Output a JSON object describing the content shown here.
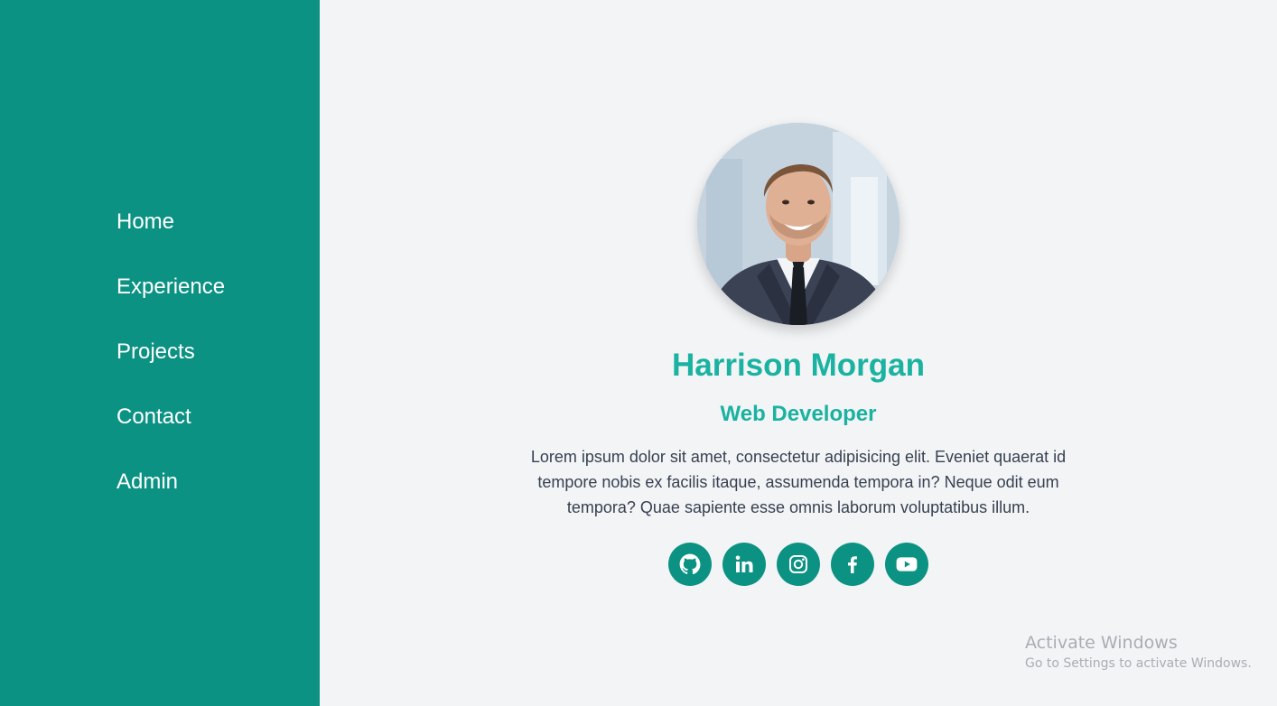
{
  "sidebar": {
    "items": [
      {
        "label": "Home"
      },
      {
        "label": "Experience"
      },
      {
        "label": "Projects"
      },
      {
        "label": "Contact"
      },
      {
        "label": "Admin"
      }
    ]
  },
  "profile": {
    "name": "Harrison Morgan",
    "role": "Web Developer",
    "bio": "Lorem ipsum dolor sit amet, consectetur adipisicing elit. Eveniet quaerat id tempore nobis ex facilis itaque, assumenda tempora in? Neque odit eum tempora? Quae sapiente esse omnis laborum voluptatibus illum."
  },
  "socials": [
    {
      "icon": "github-icon"
    },
    {
      "icon": "linkedin-icon"
    },
    {
      "icon": "instagram-icon"
    },
    {
      "icon": "facebook-icon"
    },
    {
      "icon": "youtube-icon"
    }
  ],
  "watermark": {
    "title": "Activate Windows",
    "subtitle": "Go to Settings to activate Windows."
  },
  "colors": {
    "sidebar": "#0c9283",
    "accent": "#1ab2a0",
    "background": "#f3f4f6",
    "text": "#374151"
  }
}
